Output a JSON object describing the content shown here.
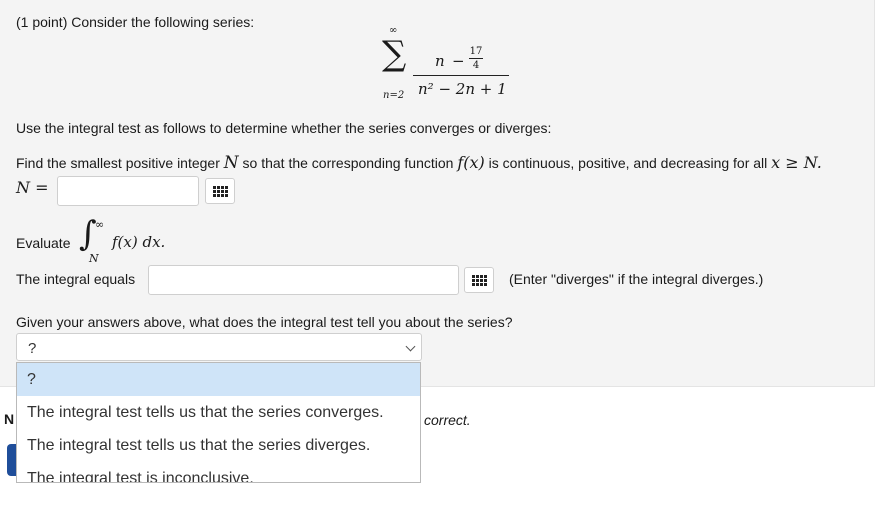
{
  "question": {
    "prompt": "(1 point) Consider the following series:",
    "series": {
      "sum_symbol": "∑",
      "upper": "∞",
      "lower": "n=2",
      "numerator_var": "n",
      "numerator_op": "−",
      "numerator_frac_num": "17",
      "numerator_frac_den": "4",
      "denominator": "n² − 2n + 1"
    },
    "instruction": "Use the integral test as follows to determine whether the series converges or diverges:",
    "find_n": {
      "text_before": "Find the smallest positive integer",
      "var_N": "N",
      "text_middle": "so that the corresponding function",
      "fx": "f(x)",
      "text_after": "is continuous, positive, and decreasing for all",
      "cond": "x ≥ N.",
      "label": "N =",
      "value": ""
    },
    "evaluate": {
      "label": "Evaluate",
      "integral_sign": "∫",
      "upper": "∞",
      "lower": "N",
      "integrand": "f(x) dx."
    },
    "integral": {
      "label": "The integral equals",
      "value": "",
      "hint": "(Enter \"diverges\" if the integral diverges.)"
    },
    "conclusion": {
      "question": "Given your answers above, what does the integral test tell you about the series?",
      "selected": "?",
      "options": [
        "?",
        "The integral test tells us that the series converges.",
        "The integral test tells us that the series diverges.",
        "The integral test is inconclusive."
      ]
    }
  },
  "footer": {
    "note_start": "N",
    "note_end": "correct."
  },
  "colors": {
    "panel_bg": "#f4f4f4",
    "option_highlight": "#cfe4f8",
    "submit_button": "#1f4e9a"
  },
  "icons": [
    "keyboard-grid-icon",
    "chevron-down-icon"
  ]
}
